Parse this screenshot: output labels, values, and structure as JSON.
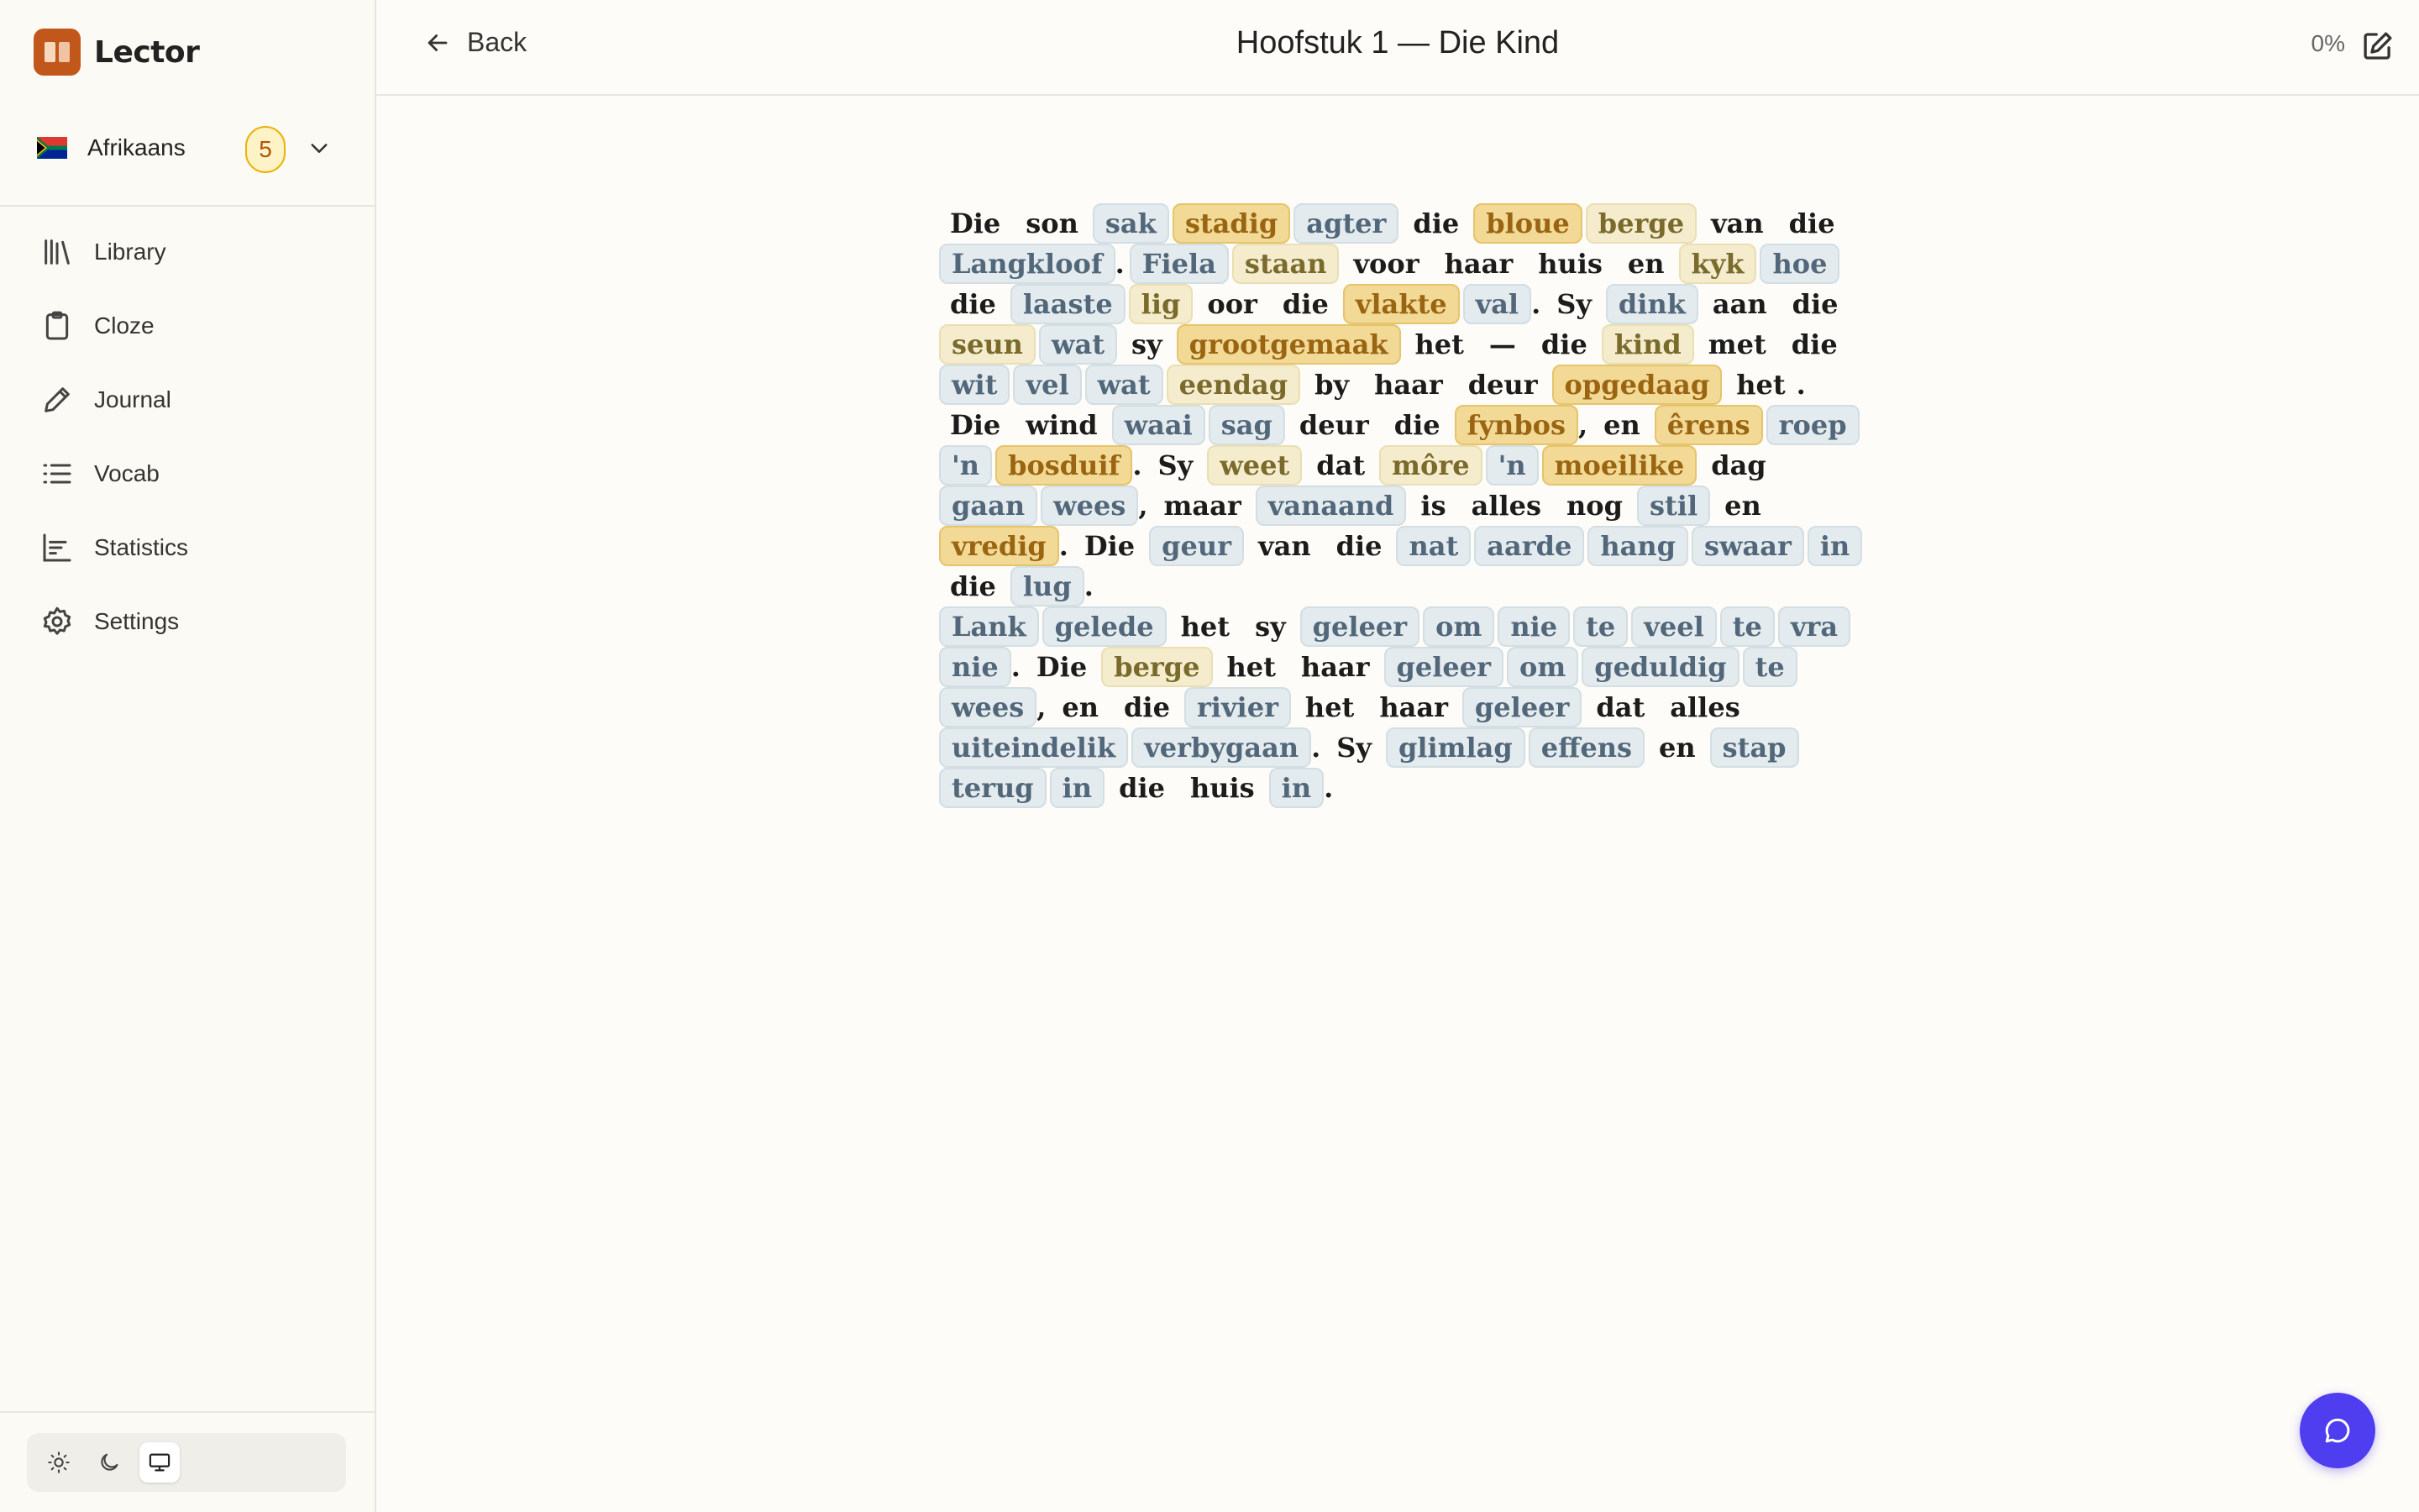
{
  "app": {
    "name": "Lector",
    "brand_color": "#c2571b"
  },
  "language": {
    "name": "Afrikaans",
    "badge_count": "5",
    "flag": "south-africa-flag"
  },
  "nav": [
    {
      "label": "Library",
      "icon": "library-icon"
    },
    {
      "label": "Cloze",
      "icon": "clipboard-icon"
    },
    {
      "label": "Journal",
      "icon": "pencil-icon"
    },
    {
      "label": "Vocab",
      "icon": "list-icon"
    },
    {
      "label": "Statistics",
      "icon": "bar-chart-icon"
    },
    {
      "label": "Settings",
      "icon": "gear-icon"
    }
  ],
  "theme": {
    "options": [
      "light",
      "dark",
      "system"
    ],
    "selected": "system"
  },
  "header": {
    "back_label": "Back",
    "title": "Hoofstuk 1 — Die Kind",
    "progress": "0%"
  },
  "highlight_colors": {
    "seen": "#e3ebee",
    "learning": "#f4eccd",
    "new": "#f2d995"
  },
  "reader": {
    "lines": [
      [
        [
          "Die",
          0
        ],
        [
          "son",
          0
        ],
        [
          "sak",
          1
        ],
        [
          "stadig",
          3
        ],
        [
          "agter",
          1
        ],
        [
          "die",
          0
        ],
        [
          "bloue",
          3
        ],
        [
          "berge",
          2
        ],
        [
          "van",
          0
        ],
        [
          "die",
          0
        ]
      ],
      [
        [
          "Langkloof",
          1
        ],
        [
          ".",
          -1
        ],
        [
          "Fiela",
          1
        ],
        [
          "staan",
          2
        ],
        [
          "voor",
          0
        ],
        [
          "haar",
          0
        ],
        [
          "huis",
          0
        ],
        [
          "en",
          0
        ],
        [
          "kyk",
          2
        ],
        [
          "hoe",
          1
        ]
      ],
      [
        [
          "die",
          0
        ],
        [
          "laaste",
          1
        ],
        [
          "lig",
          2
        ],
        [
          "oor",
          0
        ],
        [
          "die",
          0
        ],
        [
          "vlakte",
          3
        ],
        [
          "val",
          1
        ],
        [
          ".",
          -1
        ],
        [
          "Sy",
          0
        ],
        [
          "dink",
          1
        ],
        [
          "aan",
          0
        ],
        [
          "die",
          0
        ]
      ],
      [
        [
          "seun",
          2
        ],
        [
          "wat",
          1
        ],
        [
          "sy",
          0
        ],
        [
          "grootgemaak",
          3
        ],
        [
          "het",
          0
        ],
        [
          "—",
          0
        ],
        [
          "die",
          0
        ],
        [
          "kind",
          2
        ],
        [
          "met",
          0
        ],
        [
          "die",
          0
        ]
      ],
      [
        [
          "wit",
          1
        ],
        [
          "vel",
          1
        ],
        [
          "wat",
          1
        ],
        [
          "eendag",
          2
        ],
        [
          "by",
          0
        ],
        [
          "haar",
          0
        ],
        [
          "deur",
          0
        ],
        [
          "opgedaag",
          3
        ],
        [
          "het",
          0
        ],
        [
          ".",
          -1
        ]
      ],
      [
        [
          "Die",
          0
        ],
        [
          "wind",
          0
        ],
        [
          "waai",
          1
        ],
        [
          "sag",
          1
        ],
        [
          "deur",
          0
        ],
        [
          "die",
          0
        ],
        [
          "fynbos",
          3
        ],
        [
          ",",
          -1
        ],
        [
          "en",
          0
        ],
        [
          "êrens",
          3
        ],
        [
          "roep",
          1
        ]
      ],
      [
        [
          "'n",
          1
        ],
        [
          "bosduif",
          3
        ],
        [
          ".",
          -1
        ],
        [
          "Sy",
          0
        ],
        [
          "weet",
          2
        ],
        [
          "dat",
          0
        ],
        [
          "môre",
          2
        ],
        [
          "'n",
          1
        ],
        [
          "moeilike",
          3
        ],
        [
          "dag",
          0
        ]
      ],
      [
        [
          "gaan",
          1
        ],
        [
          "wees",
          1
        ],
        [
          ",",
          -1
        ],
        [
          "maar",
          0
        ],
        [
          "vanaand",
          1
        ],
        [
          "is",
          0
        ],
        [
          "alles",
          0
        ],
        [
          "nog",
          0
        ],
        [
          "stil",
          1
        ],
        [
          "en",
          0
        ]
      ],
      [
        [
          "vredig",
          3
        ],
        [
          ".",
          -1
        ],
        [
          "Die",
          0
        ],
        [
          "geur",
          1
        ],
        [
          "van",
          0
        ],
        [
          "die",
          0
        ],
        [
          "nat",
          1
        ],
        [
          "aarde",
          1
        ],
        [
          "hang",
          1
        ],
        [
          "swaar",
          1
        ],
        [
          "in",
          1
        ]
      ],
      [
        [
          "die",
          0
        ],
        [
          "lug",
          1
        ],
        [
          ".",
          -1
        ]
      ],
      [
        [
          "Lank",
          1
        ],
        [
          "gelede",
          1
        ],
        [
          "het",
          0
        ],
        [
          "sy",
          0
        ],
        [
          "geleer",
          1
        ],
        [
          "om",
          1
        ],
        [
          "nie",
          1
        ],
        [
          "te",
          1
        ],
        [
          "veel",
          1
        ],
        [
          "te",
          1
        ],
        [
          "vra",
          1
        ]
      ],
      [
        [
          "nie",
          1
        ],
        [
          ".",
          -1
        ],
        [
          "Die",
          0
        ],
        [
          "berge",
          2
        ],
        [
          "het",
          0
        ],
        [
          "haar",
          0
        ],
        [
          "geleer",
          1
        ],
        [
          "om",
          1
        ],
        [
          "geduldig",
          1
        ],
        [
          "te",
          1
        ]
      ],
      [
        [
          "wees",
          1
        ],
        [
          ",",
          -1
        ],
        [
          "en",
          0
        ],
        [
          "die",
          0
        ],
        [
          "rivier",
          1
        ],
        [
          "het",
          0
        ],
        [
          "haar",
          0
        ],
        [
          "geleer",
          1
        ],
        [
          "dat",
          0
        ],
        [
          "alles",
          0
        ]
      ],
      [
        [
          "uiteindelik",
          1
        ],
        [
          "verbygaan",
          1
        ],
        [
          ".",
          -1
        ],
        [
          "Sy",
          0
        ],
        [
          "glimlag",
          1
        ],
        [
          "effens",
          1
        ],
        [
          "en",
          0
        ],
        [
          "stap",
          1
        ]
      ],
      [
        [
          "terug",
          1
        ],
        [
          "in",
          1
        ],
        [
          "die",
          0
        ],
        [
          "huis",
          0
        ],
        [
          "in",
          1
        ],
        [
          ".",
          -1
        ]
      ]
    ]
  },
  "fab": {
    "icon": "chat-icon"
  }
}
